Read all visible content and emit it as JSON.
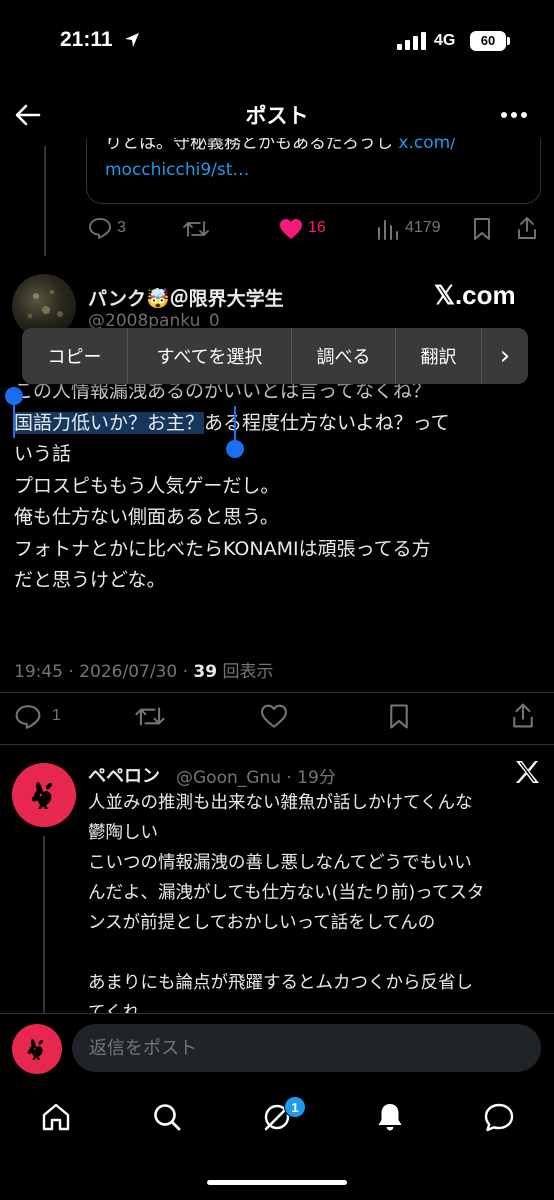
{
  "status_bar": {
    "time": "21:11",
    "network": "4G",
    "battery": "60"
  },
  "header": {
    "title": "ポスト"
  },
  "quoted_tweet": {
    "text_partial": "りとは。守秘義務とかもあるだろうし",
    "link_partial": "x.com/",
    "link_line2": "mocchicchi9/st…",
    "replies": "3",
    "likes": "16",
    "views": "4179",
    "like_color": "#f91880"
  },
  "main_tweet": {
    "author_name": "パンク🤯＠限界大学生",
    "author_handle": "@2008panku_0",
    "brand": "𝕏.com",
    "body": {
      "line1": "この人情報漏洩あるのがいいとは言ってなくね？",
      "line2_selected": "国語力低いか？お主？",
      "line2_rest": "ある程度仕方ないよね？って",
      "line3": "いう話",
      "line4": "プロスピももう人気ゲーだし。",
      "line5": "俺も仕方ない側面あると思う。",
      "line6": "フォトナとかに比べたらKONAMIは頑張ってる方",
      "line7": "だと思うけどな。"
    },
    "timestamp": "19:45 · 2026/07/30 · ",
    "view_count": "39",
    "view_label": " 回表示",
    "replies": "1",
    "selection_color": "#1d6ff2"
  },
  "context_menu": {
    "items": [
      "コピー",
      "すべてを選択",
      "調べる",
      "翻訳"
    ],
    "more": "›"
  },
  "reply": {
    "name": "ペペロン",
    "meta": "@Goon_Gnu · 19分",
    "lines": [
      "人並みの推測も出来ない雑魚が話しかけてくんな",
      "鬱陶しい",
      "こいつの情報漏洩の善し悪しなんてどうでもいい",
      "んだよ、漏洩がしても仕方ない(当たり前)ってスタ",
      "ンスが前提としておかしいって話をしてんの",
      "",
      "あまりにも論点が飛躍するとムカつくから反省し",
      "てくれ"
    ],
    "avatar_color": "#e8274f"
  },
  "compose": {
    "placeholder": "返信をポスト"
  },
  "bottom_nav": {
    "badge": "1",
    "accent": "#1d9bf0"
  }
}
